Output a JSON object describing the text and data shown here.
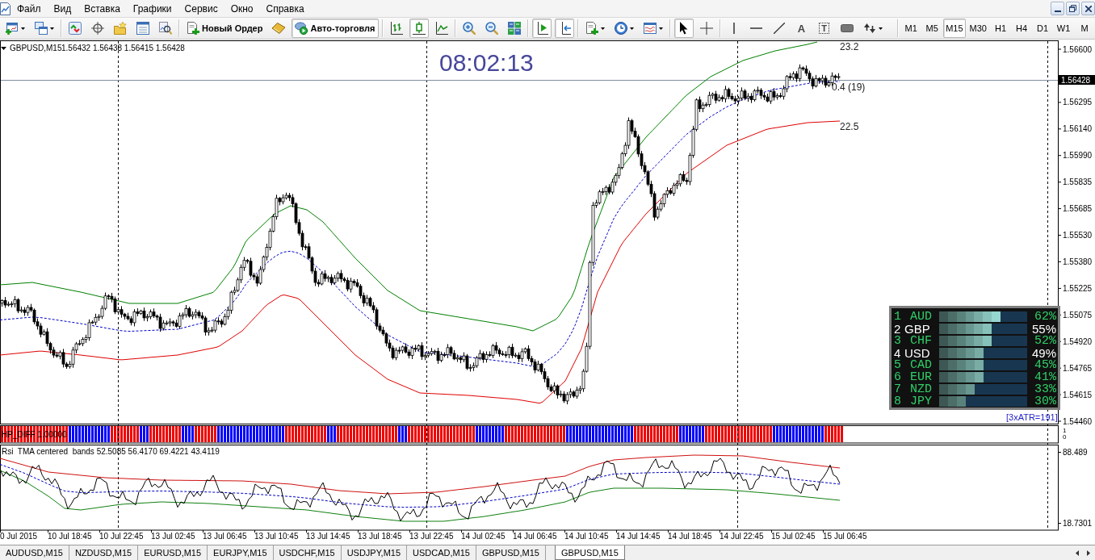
{
  "menu_bar": {
    "items": [
      "Файл",
      "Вид",
      "Вставка",
      "Графики",
      "Сервис",
      "Окно",
      "Справка"
    ]
  },
  "window_controls": [
    {
      "kind": "minimize"
    },
    {
      "kind": "restore"
    },
    {
      "kind": "close"
    }
  ],
  "toolbar": {
    "groups": [
      [
        {
          "kind": "newchart",
          "dropdown": true
        },
        {
          "kind": "profiles",
          "dropdown": true
        }
      ],
      [
        {
          "kind": "marketwatch"
        },
        {
          "kind": "datawindow"
        },
        {
          "kind": "navigator"
        },
        {
          "kind": "terminal"
        },
        {
          "kind": "tester"
        }
      ],
      [
        {
          "kind": "neworder",
          "label": "Новый Ордер"
        },
        {
          "kind": "editor"
        },
        {
          "kind": "autotrading",
          "label": "Авто-торговля",
          "on": true
        }
      ],
      [
        {
          "kind": "barchart",
          "selected": false
        },
        {
          "kind": "candles",
          "selected": true
        },
        {
          "kind": "linechart",
          "selected": false
        }
      ],
      [
        {
          "kind": "zoomin"
        },
        {
          "kind": "zoomout"
        },
        {
          "kind": "tile"
        }
      ],
      [
        {
          "kind": "shift",
          "on": true
        },
        {
          "kind": "autoscroll",
          "on": true
        }
      ],
      [
        {
          "kind": "indicators",
          "dropdown": true
        },
        {
          "kind": "periods",
          "dropdown": true
        },
        {
          "kind": "templates",
          "dropdown": true
        }
      ],
      [
        {
          "kind": "cursor",
          "selected": true
        },
        {
          "kind": "crosshair",
          "selected": false
        }
      ],
      [
        {
          "kind": "vline"
        },
        {
          "kind": "hline"
        },
        {
          "kind": "trendline"
        },
        {
          "kind": "text",
          "glyph": "A"
        },
        {
          "kind": "label",
          "glyph": "T"
        },
        {
          "kind": "rectangle"
        },
        {
          "kind": "arrows",
          "dropdown": true
        }
      ],
      [
        {
          "kind": "timeframe",
          "label": "M1",
          "selected": false
        },
        {
          "kind": "timeframe",
          "label": "M5",
          "selected": false
        },
        {
          "kind": "timeframe",
          "label": "M15",
          "selected": true
        },
        {
          "kind": "timeframe",
          "label": "M30",
          "selected": false
        },
        {
          "kind": "timeframe",
          "label": "H1",
          "selected": false
        },
        {
          "kind": "timeframe",
          "label": "H4",
          "selected": false
        },
        {
          "kind": "timeframe",
          "label": "D1",
          "selected": false
        },
        {
          "kind": "timeframe",
          "label": "W1",
          "selected": false
        },
        {
          "kind": "timeframe",
          "label": "M",
          "selected": false
        }
      ]
    ]
  },
  "chart": {
    "symbol": "GBPUSD,M15",
    "quotes": "1.56432 1.56438 1.56415 1.56428",
    "clock": "08:02:13",
    "band_labels": [
      "23.2",
      "0.4 (19)",
      "22.5"
    ],
    "price_axis": [
      "1.56600",
      "1.56295",
      "1.56140",
      "1.55990",
      "1.55835",
      "1.55685",
      "1.55530",
      "1.55380",
      "1.55225",
      "1.55075",
      "1.54920",
      "1.54765",
      "1.54615",
      "1.54460"
    ],
    "current_price": "1.56428",
    "atr_label": "[3xATR=191]",
    "strength_panel": {
      "rows": [
        {
          "rank": "1",
          "currency": "AUD",
          "level": 0.7,
          "percent": "62%",
          "highlighted": false
        },
        {
          "rank": "2",
          "currency": "GBP",
          "level": 0.6,
          "percent": "55%",
          "highlighted": true
        },
        {
          "rank": "3",
          "currency": "CHF",
          "level": 0.6,
          "percent": "52%",
          "highlighted": false
        },
        {
          "rank": "4",
          "currency": "USD",
          "level": 0.5,
          "percent": "49%",
          "highlighted": true
        },
        {
          "rank": "5",
          "currency": "CAD",
          "level": 0.5,
          "percent": "45%",
          "highlighted": false
        },
        {
          "rank": "6",
          "currency": "EUR",
          "level": 0.5,
          "percent": "41%",
          "highlighted": false
        },
        {
          "rank": "7",
          "currency": "NZD",
          "level": 0.4,
          "percent": "33%",
          "highlighted": false
        },
        {
          "rank": "8",
          "currency": "JPY",
          "level": 0.3,
          "percent": "30%",
          "highlighted": false
        }
      ]
    }
  },
  "hp_diff": {
    "label": "HP_DIFF 1.00000",
    "axis": [
      "1",
      "0"
    ]
  },
  "rsi": {
    "label": "Rsi  TMA centered  bands 52.5085 56.4170 69.4221 43.4119",
    "axis": [
      "88.489",
      "18.7301"
    ]
  },
  "time_axis": [
    "0 Jul 2015",
    "10 Jul 18:45",
    "10 Jul 22:45",
    "13 Jul 02:45",
    "13 Jul 06:45",
    "13 Jul 10:45",
    "13 Jul 14:45",
    "13 Jul 18:45",
    "13 Jul 22:45",
    "14 Jul 02:45",
    "14 Jul 06:45",
    "14 Jul 10:45",
    "14 Jul 14:45",
    "14 Jul 18:45",
    "14 Jul 22:45",
    "15 Jul 02:45",
    "15 Jul 06:45"
  ],
  "tabs": [
    {
      "label": "AUDUSD,M15",
      "selected": false
    },
    {
      "label": "NZDUSD,M15",
      "selected": false
    },
    {
      "label": "EURUSD,M15",
      "selected": false
    },
    {
      "label": "EURJPY,M15",
      "selected": false
    },
    {
      "label": "USDCHF,M15",
      "selected": false
    },
    {
      "label": "USDJPY,M15",
      "selected": false
    },
    {
      "label": "USDCAD,M15",
      "selected": false
    },
    {
      "label": "GBPUSD,M15",
      "selected": false
    },
    {
      "label": "GBPUSD,M15",
      "selected": true
    }
  ]
}
